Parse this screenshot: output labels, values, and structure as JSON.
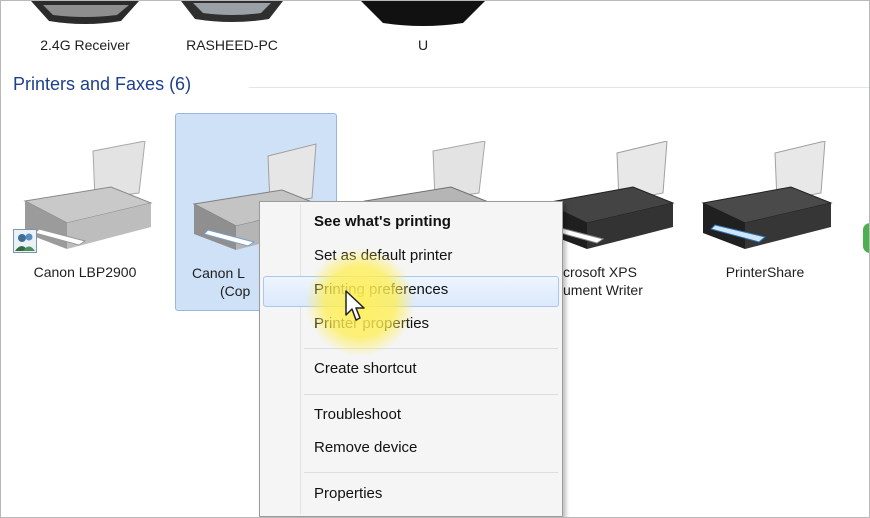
{
  "top_devices": [
    {
      "label": "2.4G Receiver"
    },
    {
      "label": "RASHEED-PC"
    },
    {
      "label": "U"
    }
  ],
  "group": {
    "title": "Printers and Faxes (6)"
  },
  "printers": [
    {
      "label": "Canon LBP2900"
    },
    {
      "label_line1": "Canon L",
      "label_line2": "(Cop"
    },
    {
      "label": ""
    },
    {
      "label_line1": "crosoft XPS",
      "label_line2": "ument Writer"
    },
    {
      "label": "PrinterShare"
    }
  ],
  "context_menu": {
    "items": [
      {
        "label": "See what's printing"
      },
      {
        "label": "Set as default printer"
      },
      {
        "label": "Printing preferences"
      },
      {
        "label": "Printer properties"
      },
      {
        "label": "Create shortcut"
      },
      {
        "label": "Troubleshoot"
      },
      {
        "label": "Remove device"
      },
      {
        "label": "Properties"
      }
    ],
    "hovered_item": "Printing preferences"
  },
  "colors": {
    "group_title": "#1e3f8e",
    "selection": "#cfe1f7",
    "highlight": "#fff05a"
  }
}
